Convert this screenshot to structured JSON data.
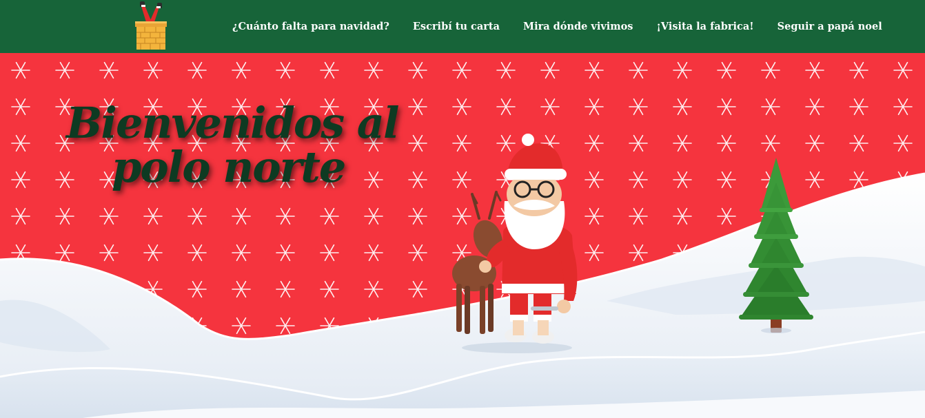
{
  "header": {
    "nav": [
      {
        "label": "¿Cuánto falta para navidad?"
      },
      {
        "label": "Escribí tu carta"
      },
      {
        "label": "Mira dónde vivimos"
      },
      {
        "label": "¡Visita la fabrica!"
      },
      {
        "label": "Seguir a papá noel"
      }
    ],
    "logo_icon": "santa-chimney-icon"
  },
  "hero": {
    "title_line1": "Bienvenidos al",
    "title_line2": "polo norte",
    "santa_icon": "santa-reindeer-illustration",
    "tree_icon": "christmas-tree-icon"
  },
  "colors": {
    "header_bg": "#176439",
    "hero_red": "#f5343e",
    "snow": "#eef2f7",
    "title_text": "#0e3a22"
  }
}
